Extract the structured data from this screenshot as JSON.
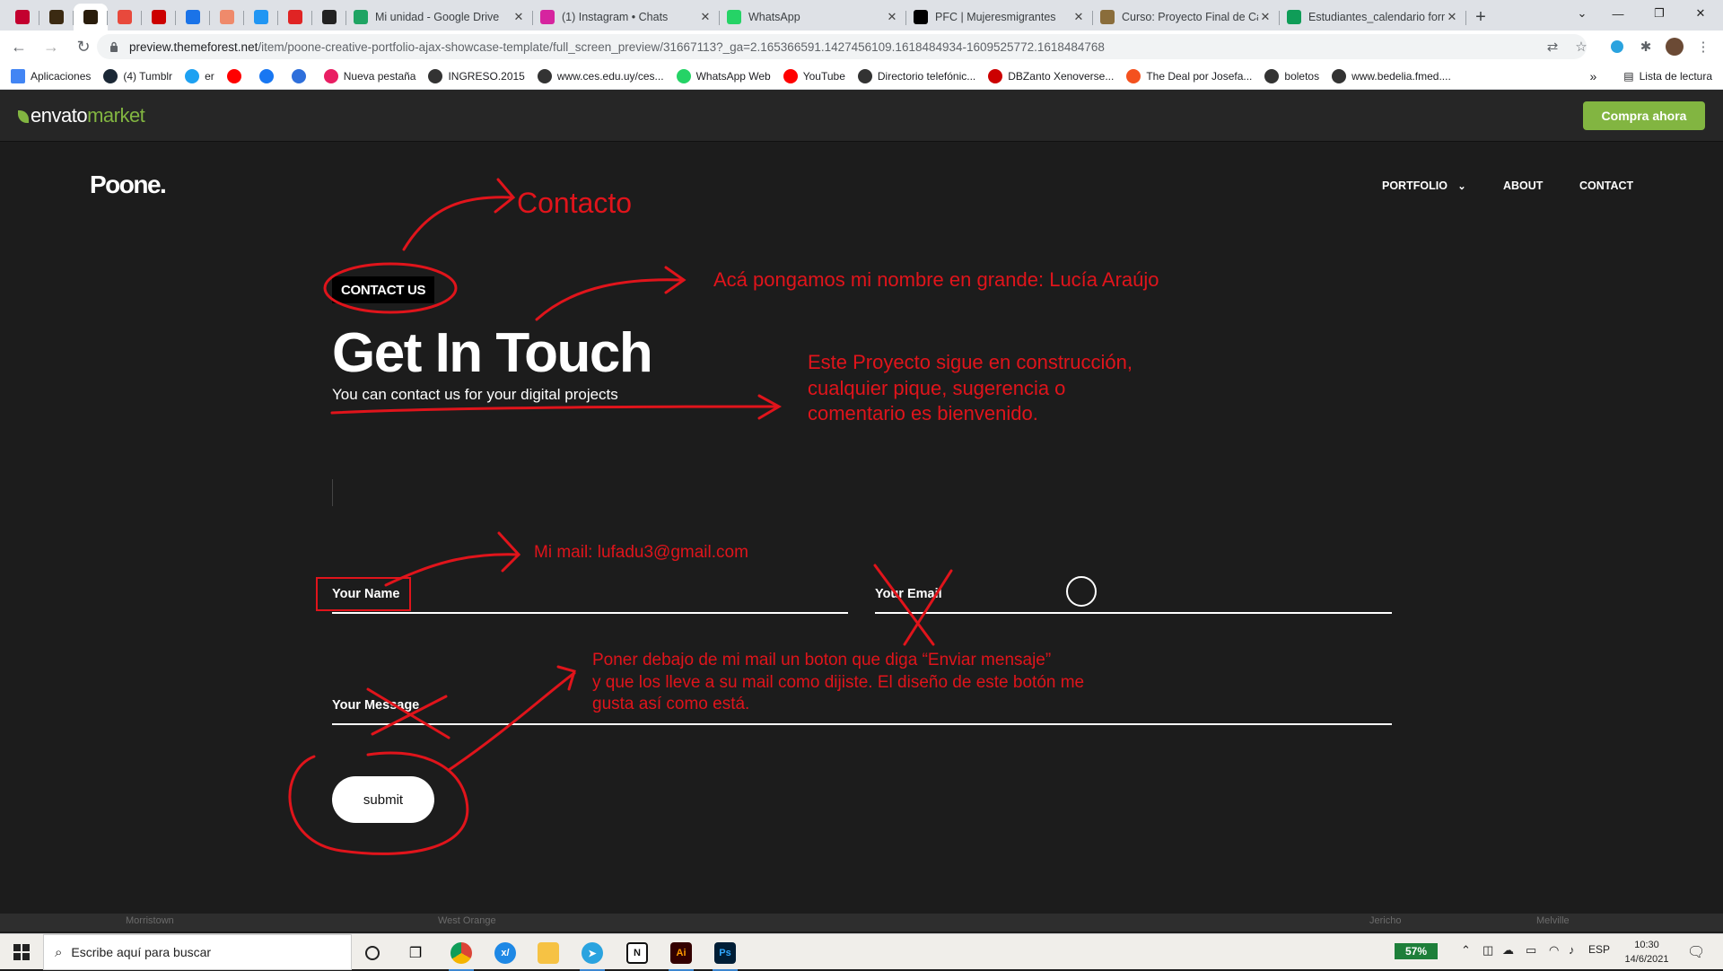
{
  "browser": {
    "tabs": [
      {
        "title": "Mi unidad - Google Drive",
        "fav_color": "#1fa463"
      },
      {
        "title": "(1) Instagram • Chats",
        "fav_color": "#d6249f"
      },
      {
        "title": "WhatsApp",
        "fav_color": "#25d366"
      },
      {
        "title": "PFC | Mujeresmigrantes",
        "fav_color": "#000000"
      },
      {
        "title": "Curso: Proyecto Final de Ca",
        "fav_color": "#8a6d3b"
      },
      {
        "title": "Estudiantes_calendario form",
        "fav_color": "#0f9d58"
      }
    ],
    "mini_tab_colors": [
      "#c3002f",
      "#3b2a12",
      "#2a1d0c",
      "#e8493c",
      "#cc0000",
      "#1a73e8",
      "#ef8a6b",
      "#2196f3",
      "#e02424",
      "#222222"
    ],
    "url_host": "preview.themeforest.net",
    "url_path": "/item/poone-creative-portfolio-ajax-showcase-template/full_screen_preview/31667113?_ga=2.165366591.1427456109.1618484934-1609525772.1618484768",
    "bookmarks": [
      {
        "label": "Aplicaciones",
        "color": "#4285f4"
      },
      {
        "label": "(4) Tumblr",
        "color": "#1b2836"
      },
      {
        "label": "er",
        "color": "#1da1f2"
      },
      {
        "label": "",
        "color": "#ff0000"
      },
      {
        "label": "",
        "color": "#1877f2"
      },
      {
        "label": "",
        "color": "#2e6fdb"
      },
      {
        "label": "Nueva pestaña",
        "color": "#e91e63"
      },
      {
        "label": "INGRESO.2015",
        "color": "#333333"
      },
      {
        "label": "www.ces.edu.uy/ces...",
        "color": "#333333"
      },
      {
        "label": "WhatsApp Web",
        "color": "#25d366"
      },
      {
        "label": "YouTube",
        "color": "#ff0000"
      },
      {
        "label": "Directorio telefónic...",
        "color": "#333333"
      },
      {
        "label": "DBZanto Xenoverse...",
        "color": "#cc0000"
      },
      {
        "label": "The Deal por Josefa...",
        "color": "#f4511e"
      },
      {
        "label": "boletos",
        "color": "#333333"
      },
      {
        "label": "www.bedelia.fmed....",
        "color": "#333333"
      }
    ],
    "reading_list": "Lista de lectura"
  },
  "envato": {
    "logo_main": "envato",
    "logo_accent": "market",
    "buy_label": "Compra ahora"
  },
  "site": {
    "logo": "Poone.",
    "nav": {
      "portfolio": "PORTFOLIO",
      "about": "ABOUT",
      "contact": "CONTACT"
    },
    "badge": "CONTACT US",
    "headline": "Get In Touch",
    "subline": "You can contact us for your digital projects",
    "form": {
      "name_label": "Your Name",
      "email_label": "Your Email",
      "message_label": "Your Message",
      "submit_label": "submit"
    }
  },
  "annotations": {
    "contacto": "Contacto",
    "nombre": "Acá pongamos mi nombre en grande: Lucía Araújo",
    "proyecto_1": "Este Proyecto sigue en construcción,",
    "proyecto_2": "cualquier pique, sugerencia o",
    "proyecto_3": "comentario es bienvenido.",
    "mail": "Mi mail: lufadu3@gmail.com",
    "boton_1": "Poner debajo de mi mail un boton que diga “Enviar mensaje”",
    "boton_2": "y que los lleve a su mail como dijiste. El diseño de este botón me",
    "boton_3": "gusta así como está.",
    "color": "#e0141b"
  },
  "map_labels": [
    "Morristown",
    "West Orange",
    "Jericho",
    "Melville"
  ],
  "taskbar": {
    "search_placeholder": "Escribe aquí para buscar",
    "battery": "57%",
    "language": "ESP",
    "time": "10:30",
    "date": "14/6/2021"
  }
}
